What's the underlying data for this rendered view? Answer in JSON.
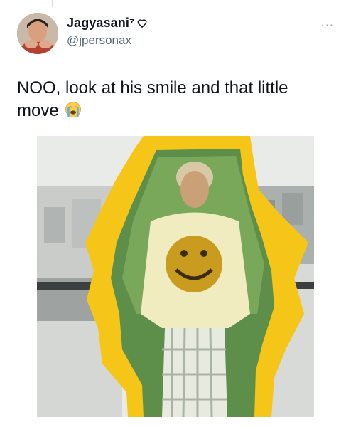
{
  "tweet": {
    "author": {
      "display_name": "Jagyasani⁷",
      "handle": "@jpersonax",
      "avatar_icon": "avatar-photo"
    },
    "text": "NOO, look at his smile and that little move",
    "emoji": "loudly-crying-face",
    "more_icon": "more-options-icon",
    "more_glyph": "···",
    "media": {
      "type": "video-thumbnail",
      "accent_color": "#f5c518"
    }
  }
}
